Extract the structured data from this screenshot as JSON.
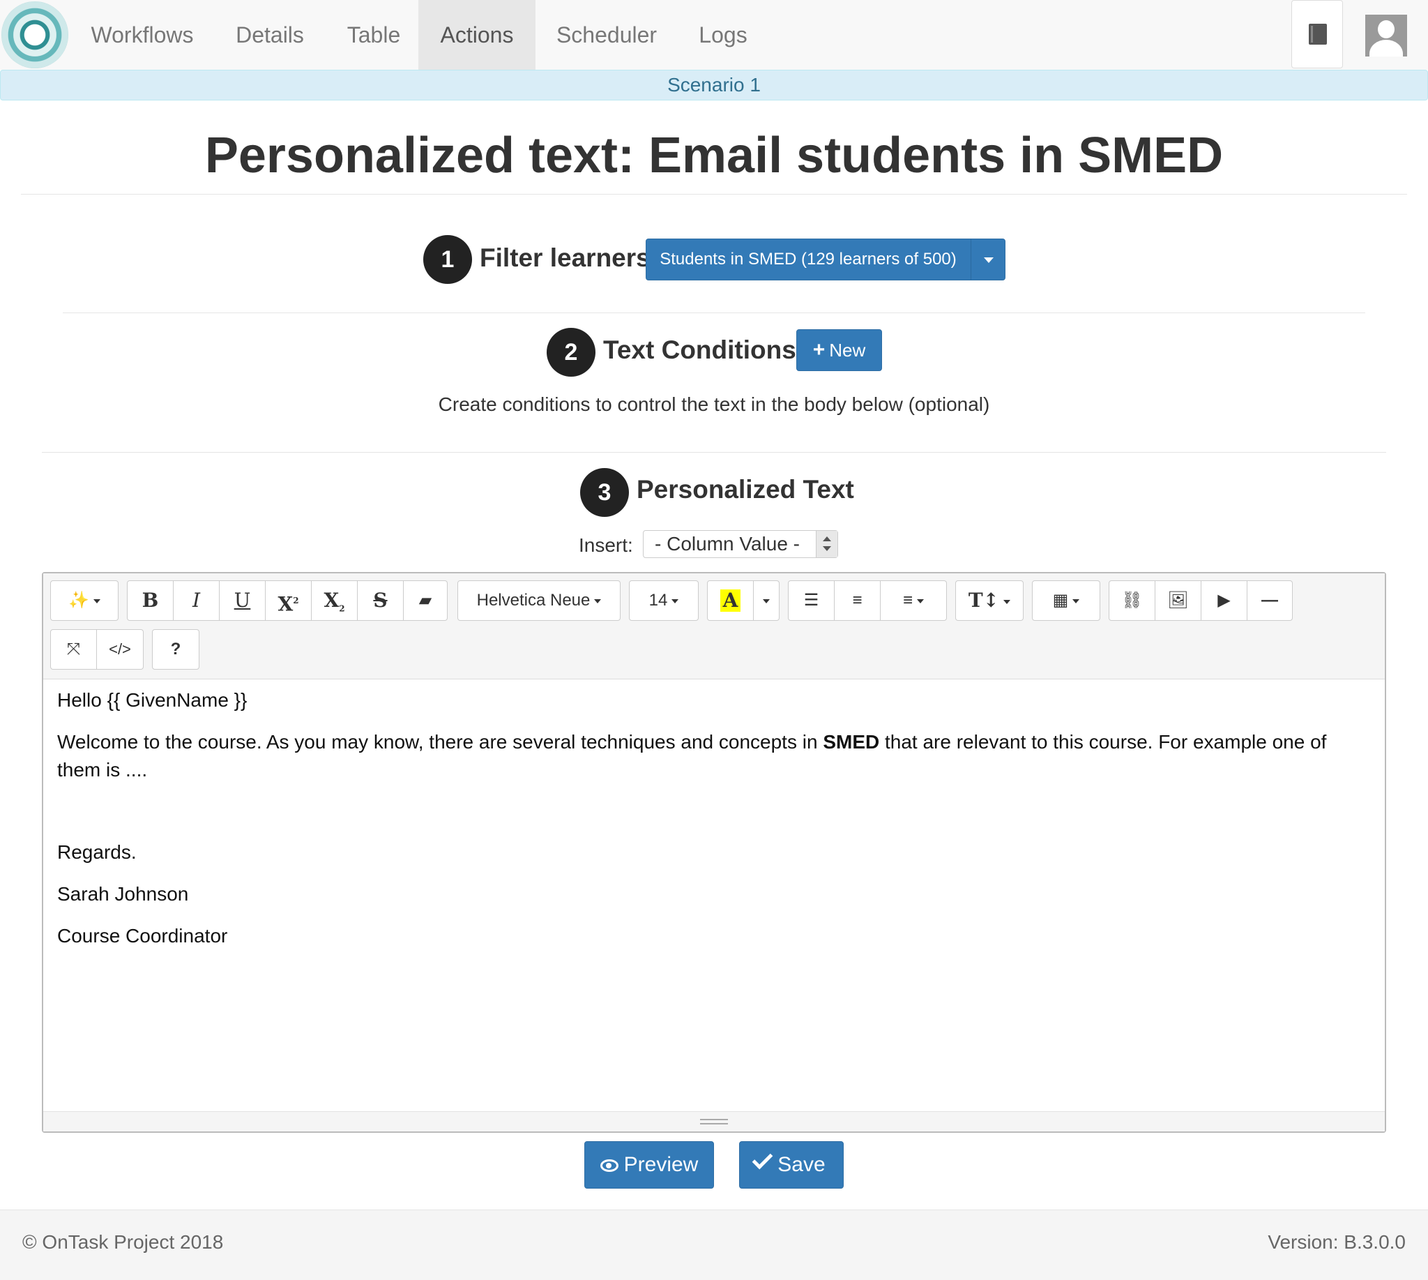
{
  "nav": {
    "items": [
      "Workflows",
      "Details",
      "Table",
      "Actions",
      "Scheduler",
      "Logs"
    ],
    "active": "Actions"
  },
  "scenario": "Scenario 1",
  "page_title": "Personalized text: Email students in SMED",
  "steps": {
    "filter": {
      "number": "1",
      "label": "Filter learners",
      "button": "Students in SMED (129 learners of 500)"
    },
    "conditions": {
      "number": "2",
      "label": "Text Conditions",
      "button": "New",
      "help": "Create conditions to control the text in the body below (optional)"
    },
    "text": {
      "number": "3",
      "label": "Personalized Text",
      "insert_label": "Insert:",
      "insert_value": "- Column Value -"
    }
  },
  "toolbar": {
    "font_name": "Helvetica Neue",
    "font_size": "14",
    "bold": "B",
    "italic": "I",
    "underline": "U",
    "code_view": "</>",
    "help": "?"
  },
  "editor": {
    "greeting": "Hello {{ GivenName }}",
    "body_before": "Welcome to the course. As you may know, there are several techniques and concepts in ",
    "body_bold": "SMED",
    "body_after": " that are relevant to this course. For example one of them is ....",
    "closing": "Regards.",
    "name": "Sarah Johnson",
    "role": "Course Coordinator"
  },
  "buttons": {
    "preview": "Preview",
    "save": "Save"
  },
  "footer": {
    "copyright": "© OnTask Project 2018",
    "version": "Version: B.3.0.0"
  },
  "colors": {
    "primary": "#337ab7",
    "scenario_bg": "#d9edf7",
    "scenario_text": "#31708f"
  }
}
